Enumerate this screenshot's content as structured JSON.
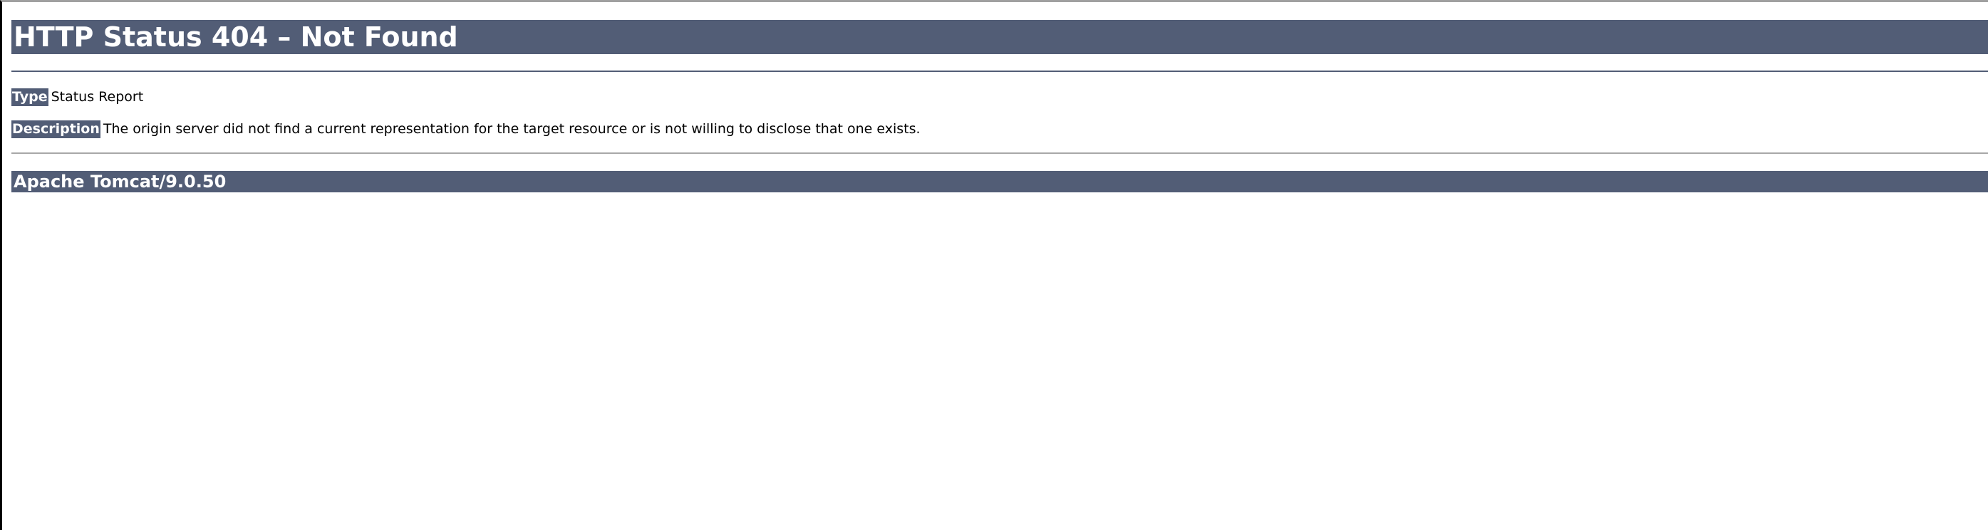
{
  "page": {
    "title": "HTTP Status 404 – Not Found",
    "type_label": "Type",
    "type_value": "Status Report",
    "description_label": "Description",
    "description_value": "The origin server did not find a current representation for the target resource or is not willing to disclose that one exists.",
    "server_signature": "Apache Tomcat/9.0.50"
  },
  "colors": {
    "header_bg": "#525d76",
    "header_text": "#ffffff",
    "body_text": "#000000",
    "background": "#ffffff"
  }
}
